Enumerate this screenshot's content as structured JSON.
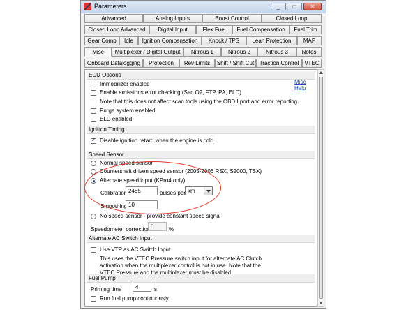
{
  "window": {
    "title": "Parameters",
    "min": "_",
    "max": "□",
    "close": "✕"
  },
  "tabs": {
    "row1": [
      "Advanced",
      "Analog Inputs",
      "Boost Control",
      "Closed Loop"
    ],
    "row2": [
      "Closed Loop Advanced",
      "Digital Input",
      "Flex Fuel",
      "Fuel Compensation",
      "Fuel Trim"
    ],
    "row3": [
      "Gear Comp",
      "Idle",
      "Ignition Compensation",
      "Knock / TPS",
      "Lean Protection",
      "MAP"
    ],
    "row4": [
      "Misc",
      "Multiplexer / Digital Output",
      "Nitrous 1",
      "Nitrous 2",
      "Nitrous 3",
      "Notes"
    ],
    "row5": [
      "Onboard Datalogging",
      "Protection",
      "Rev Limits",
      "Shift / Shift Cut",
      "Traction Control",
      "VTEC"
    ]
  },
  "ecu": {
    "header": "ECU Options",
    "help": "Misc Help",
    "immobilizer": "Immobilizer enabled",
    "emissions": "Enable emissions error checking (Sec O2, FTP, PA, ELD)",
    "note": "Note that this does not affect scan tools using the OBDII port and error reporting.",
    "purge": "Purge system enabled",
    "eld": "ELD enabled"
  },
  "ign": {
    "header": "Ignition Timing",
    "retard": "Disable ignition retard when the engine is cold"
  },
  "speed": {
    "header": "Speed Sensor",
    "normal": "Normal speed sensor",
    "countershaft": "Countershaft driven speed sensor (2005-2006 RSX, S2000, TSX)",
    "alternate": "Alternate speed input (KPro4 only)",
    "calibration_label": "Calibration",
    "calibration_value": "2485",
    "pulses_per": "pulses per",
    "unit": "km",
    "smoothing_label": "Smoothing",
    "smoothing_value": "10",
    "none": "No speed sensor - provide constant speed signal",
    "correction_label": "Speedometer correction",
    "correction_value": "0",
    "correction_unit": "%"
  },
  "ac": {
    "header": "Alternate AC Switch Input",
    "use_vtp": "Use VTP as AC Switch Input",
    "desc1": "This uses the VTEC Pressure switch input for alternate AC Clutch",
    "desc2": "activation when the multiplexer control is not in use. Note that the",
    "desc3": "VTEC Pressure and the multiplexer must be disabled."
  },
  "fuel": {
    "header": "Fuel Pump",
    "priming_label": "Priming time",
    "priming_value": "4",
    "priming_unit": "s",
    "continuous": "Run fuel pump continuously"
  },
  "colors": {
    "annotation": "#e23a2a",
    "link": "#1a50c8"
  }
}
